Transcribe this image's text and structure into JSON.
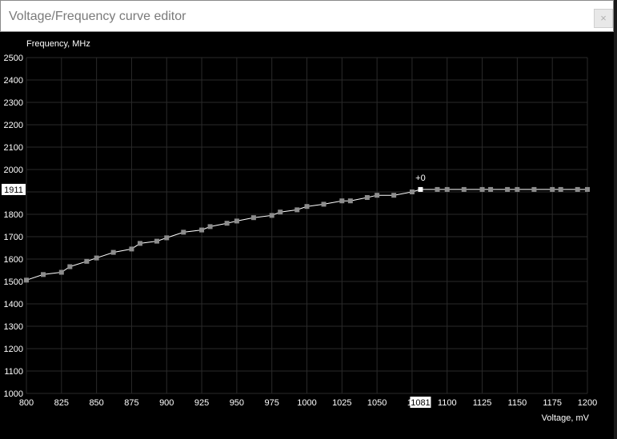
{
  "window": {
    "title": "Voltage/Frequency curve editor",
    "close_glyph": "×"
  },
  "chart_data": {
    "type": "line",
    "xlabel": "Voltage, mV",
    "ylabel": "Frequency, MHz",
    "xlim": [
      800,
      1200
    ],
    "ylim": [
      1000,
      2500
    ],
    "x_ticks": [
      800,
      825,
      850,
      875,
      900,
      925,
      950,
      975,
      1000,
      1025,
      1050,
      1075,
      1100,
      1125,
      1150,
      1175,
      1200
    ],
    "x_tick_labels": [
      "800",
      "825",
      "850",
      "875",
      "900",
      "925",
      "950",
      "975",
      "1000",
      "1025",
      "1050",
      "10",
      "1100",
      "1125",
      "1150",
      "1175",
      "1200"
    ],
    "y_ticks": [
      1000,
      1100,
      1200,
      1300,
      1400,
      1500,
      1600,
      1700,
      1800,
      1900,
      2000,
      2100,
      2200,
      2300,
      2400,
      2500
    ],
    "grid": true,
    "series": [
      {
        "x": [
          800,
          812,
          825,
          831,
          843,
          850,
          862,
          875,
          881,
          893,
          900,
          912,
          925,
          931,
          943,
          950,
          962,
          975,
          981,
          993,
          1000,
          1012,
          1025,
          1031,
          1043,
          1050,
          1062,
          1075,
          1081,
          1093,
          1100,
          1112,
          1125,
          1131,
          1143,
          1150,
          1162,
          1175,
          1181,
          1193,
          1200
        ],
        "y": [
          1506,
          1531,
          1541,
          1566,
          1590,
          1605,
          1630,
          1645,
          1670,
          1680,
          1695,
          1720,
          1730,
          1745,
          1760,
          1770,
          1785,
          1795,
          1810,
          1820,
          1835,
          1845,
          1860,
          1860,
          1875,
          1885,
          1885,
          1900,
          1911,
          1911,
          1911,
          1911,
          1911,
          1911,
          1911,
          1911,
          1911,
          1911,
          1911,
          1911,
          1911
        ]
      }
    ],
    "selected_point": {
      "x": 1081,
      "y": 1911
    },
    "cursor_voltage_label": "1081",
    "cursor_frequency_label": "1911",
    "offset_label": "+0",
    "colors": {
      "background": "#000000",
      "grid": "#2a2a2a",
      "line": "#ffffff",
      "marker": "#8c8c8c",
      "selected_marker": "#ffffff"
    }
  }
}
